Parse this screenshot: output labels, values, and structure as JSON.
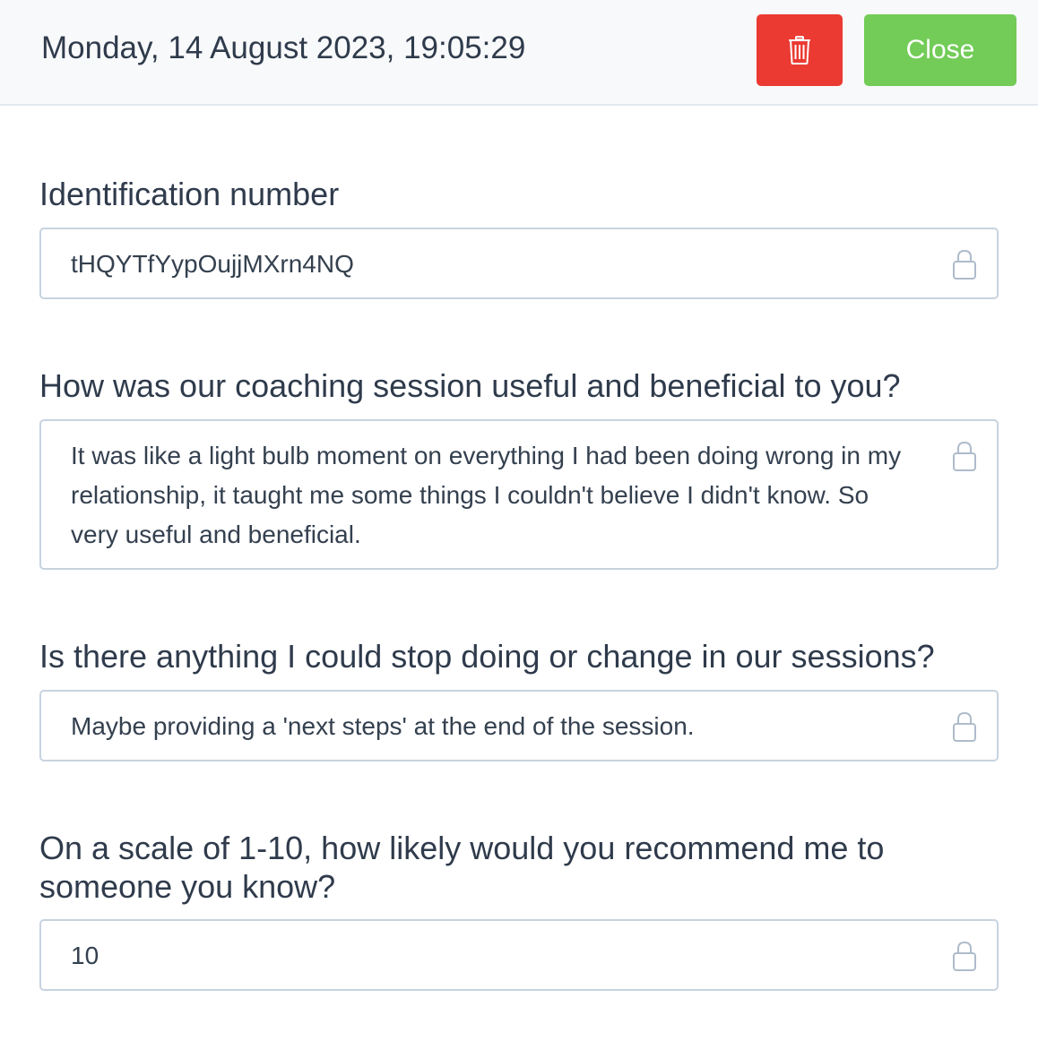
{
  "header": {
    "title": "Monday, 14 August 2023, 19:05:29",
    "delete_icon": "trash-icon",
    "close_label": "Close"
  },
  "fields": [
    {
      "label": "Identification number",
      "value": "tHQYTfYypOujjMXrn4NQ",
      "icon": "lock-icon"
    },
    {
      "label": "How was our coaching session useful and beneficial to you?",
      "value": "It was like a light bulb moment on everything I had been doing wrong in my relationship, it taught me some things I couldn't believe I didn't know. So very useful and beneficial.",
      "icon": "lock-icon"
    },
    {
      "label": "Is there anything I could stop doing or change in our sessions?",
      "value": "Maybe providing a 'next steps' at the end of the session.",
      "icon": "lock-icon"
    },
    {
      "label": "On a scale of 1-10, how likely would you recommend me to someone you know?",
      "value": "10",
      "icon": "lock-icon"
    }
  ],
  "colors": {
    "delete": "#ea3a32",
    "close": "#72cc57",
    "border": "#c7d3df",
    "text": "#2f3b4c"
  }
}
